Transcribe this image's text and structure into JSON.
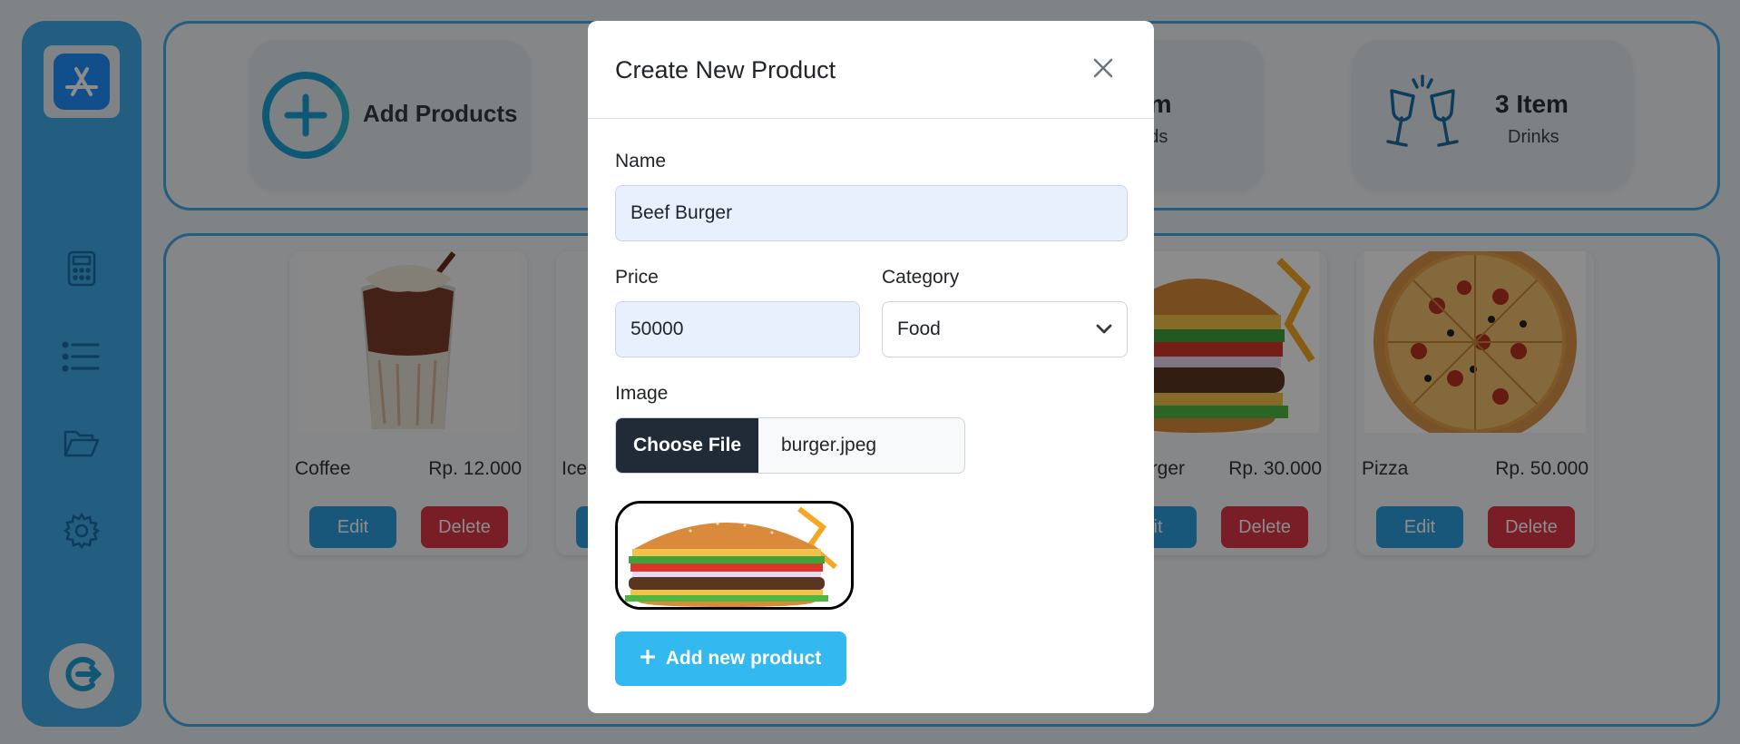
{
  "stats": {
    "add_label": "Add Products",
    "food_count": "Item",
    "food_label": "oods",
    "drink_count": "3 Item",
    "drink_label": "Drinks"
  },
  "products": [
    {
      "name": "Coffee",
      "price": "Rp. 12.000",
      "edit": "Edit",
      "delete": "Delete"
    },
    {
      "name": "Ice",
      "price": "",
      "edit": "",
      "delete": ""
    },
    {
      "name": "urger",
      "price": "Rp. 30.000",
      "edit": "dit",
      "delete": "Delete"
    },
    {
      "name": "Pizza",
      "price": "Rp. 50.000",
      "edit": "Edit",
      "delete": "Delete"
    }
  ],
  "modal": {
    "title": "Create New Product",
    "name_label": "Name",
    "name_value": "Beef Burger",
    "price_label": "Price",
    "price_value": "50000",
    "category_label": "Category",
    "category_value": "Food",
    "image_label": "Image",
    "choose_file": "Choose File",
    "file_name": "burger.jpeg",
    "submit": "Add new product"
  },
  "colors": {
    "accent": "#40a9e8",
    "danger": "#dc3545",
    "submit": "#34b8f0",
    "file_button": "#212b38"
  },
  "icons": [
    "app-store-icon",
    "calculator-icon",
    "list-icon",
    "folder-icon",
    "gear-icon",
    "logout-icon",
    "plus-circle-icon",
    "cheers-icon",
    "close-icon",
    "chevron-down-icon",
    "plus-icon"
  ]
}
